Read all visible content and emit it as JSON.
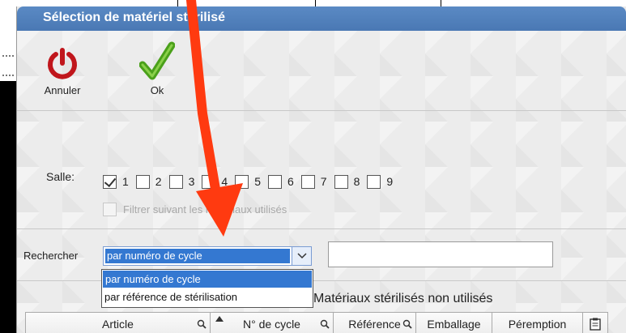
{
  "dialog": {
    "title": "Sélection de matériel stérilisé"
  },
  "toolbar": {
    "cancel_label": "Annuler",
    "ok_label": "Ok"
  },
  "salle": {
    "label": "Salle:",
    "rooms": [
      {
        "num": "1",
        "checked": true
      },
      {
        "num": "2",
        "checked": false
      },
      {
        "num": "3",
        "checked": false
      },
      {
        "num": "4",
        "checked": false
      },
      {
        "num": "5",
        "checked": false
      },
      {
        "num": "6",
        "checked": false
      },
      {
        "num": "7",
        "checked": false
      },
      {
        "num": "8",
        "checked": false
      },
      {
        "num": "9",
        "checked": false
      }
    ],
    "filter_label": "Filtrer suivant les matériaux utilisés",
    "filter_checked": false
  },
  "search": {
    "label": "Rechercher",
    "selected": "par numéro de cycle",
    "input_value": "",
    "options": [
      "par numéro de cycle",
      "par référence de stérilisation"
    ]
  },
  "list": {
    "title": "Matériaux stérilisés non utilisés",
    "columns": [
      "Article",
      "N° de cycle",
      "Référence",
      "Emballage",
      "Péremption"
    ]
  },
  "colors": {
    "title_bar": "#4a78b4",
    "selection": "#3478d1",
    "annotation_arrow": "#ff3a10",
    "cancel_icon": "#c0161c",
    "ok_icon": "#4aa01a"
  },
  "icons": [
    "power-icon",
    "checkmark-icon",
    "chevron-down-icon",
    "magnifier-icon",
    "sort-up-icon",
    "clipboard-icon"
  ]
}
